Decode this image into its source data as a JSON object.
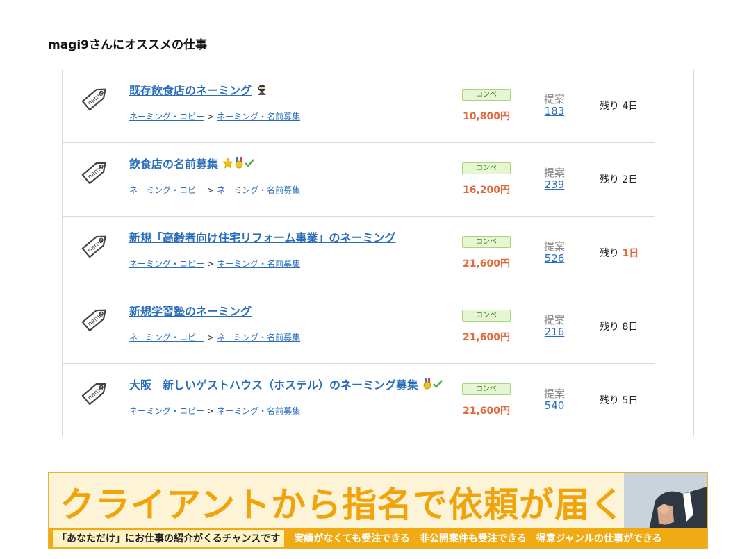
{
  "section_title": "magi9さんにオススメの仕事",
  "jobs": [
    {
      "title": "既存飲食店のネーミング",
      "badges": [
        "ninja-badge-icon"
      ],
      "category_parent": "ネーミング・コピー",
      "category_child": "ネーミング・名前募集",
      "type_label": "コンペ",
      "price": "10,800円",
      "proposal_label": "提案",
      "proposal_count": "183",
      "remaining_prefix": "残り",
      "remaining_days": "4日",
      "urgent": false
    },
    {
      "title": "飲食店の名前募集",
      "badges": [
        "star-badge-icon",
        "medal-badge-icon",
        "check-badge-icon"
      ],
      "category_parent": "ネーミング・コピー",
      "category_child": "ネーミング・名前募集",
      "type_label": "コンペ",
      "price": "16,200円",
      "proposal_label": "提案",
      "proposal_count": "239",
      "remaining_prefix": "残り",
      "remaining_days": "2日",
      "urgent": false
    },
    {
      "title": "新規「高齢者向け住宅リフォーム事業」のネーミング",
      "badges": [],
      "category_parent": "ネーミング・コピー",
      "category_child": "ネーミング・名前募集",
      "type_label": "コンペ",
      "price": "21,600円",
      "proposal_label": "提案",
      "proposal_count": "526",
      "remaining_prefix": "残り",
      "remaining_days": "1日",
      "urgent": true
    },
    {
      "title": "新規学習塾のネーミング",
      "badges": [],
      "category_parent": "ネーミング・コピー",
      "category_child": "ネーミング・名前募集",
      "type_label": "コンペ",
      "price": "21,600円",
      "proposal_label": "提案",
      "proposal_count": "216",
      "remaining_prefix": "残り",
      "remaining_days": "8日",
      "urgent": false
    },
    {
      "title": "大阪　新しいゲストハウス（ホステル）のネーミング募集",
      "badges": [
        "medal-badge-icon",
        "check-badge-icon"
      ],
      "category_parent": "ネーミング・コピー",
      "category_child": "ネーミング・名前募集",
      "type_label": "コンペ",
      "price": "21,600円",
      "proposal_label": "提案",
      "proposal_count": "540",
      "remaining_prefix": "残り",
      "remaining_days": "5日",
      "urgent": false
    }
  ],
  "tag_icon_text": "name",
  "banner": {
    "headline": "クライアントから指名で依頼が届く!?",
    "strip_highlight": "「あなただけ」にお仕事の紹介がくるチャンスです",
    "strip_items": [
      "実績がなくても受注できる",
      "非公開案件も受注できる",
      "得意ジャンルの仕事ができる"
    ]
  },
  "colors": {
    "link": "#2a6ebb",
    "price": "#e06a3c",
    "comp_badge_bg": "#e6f6d4",
    "banner_orange": "#f0a30a"
  }
}
